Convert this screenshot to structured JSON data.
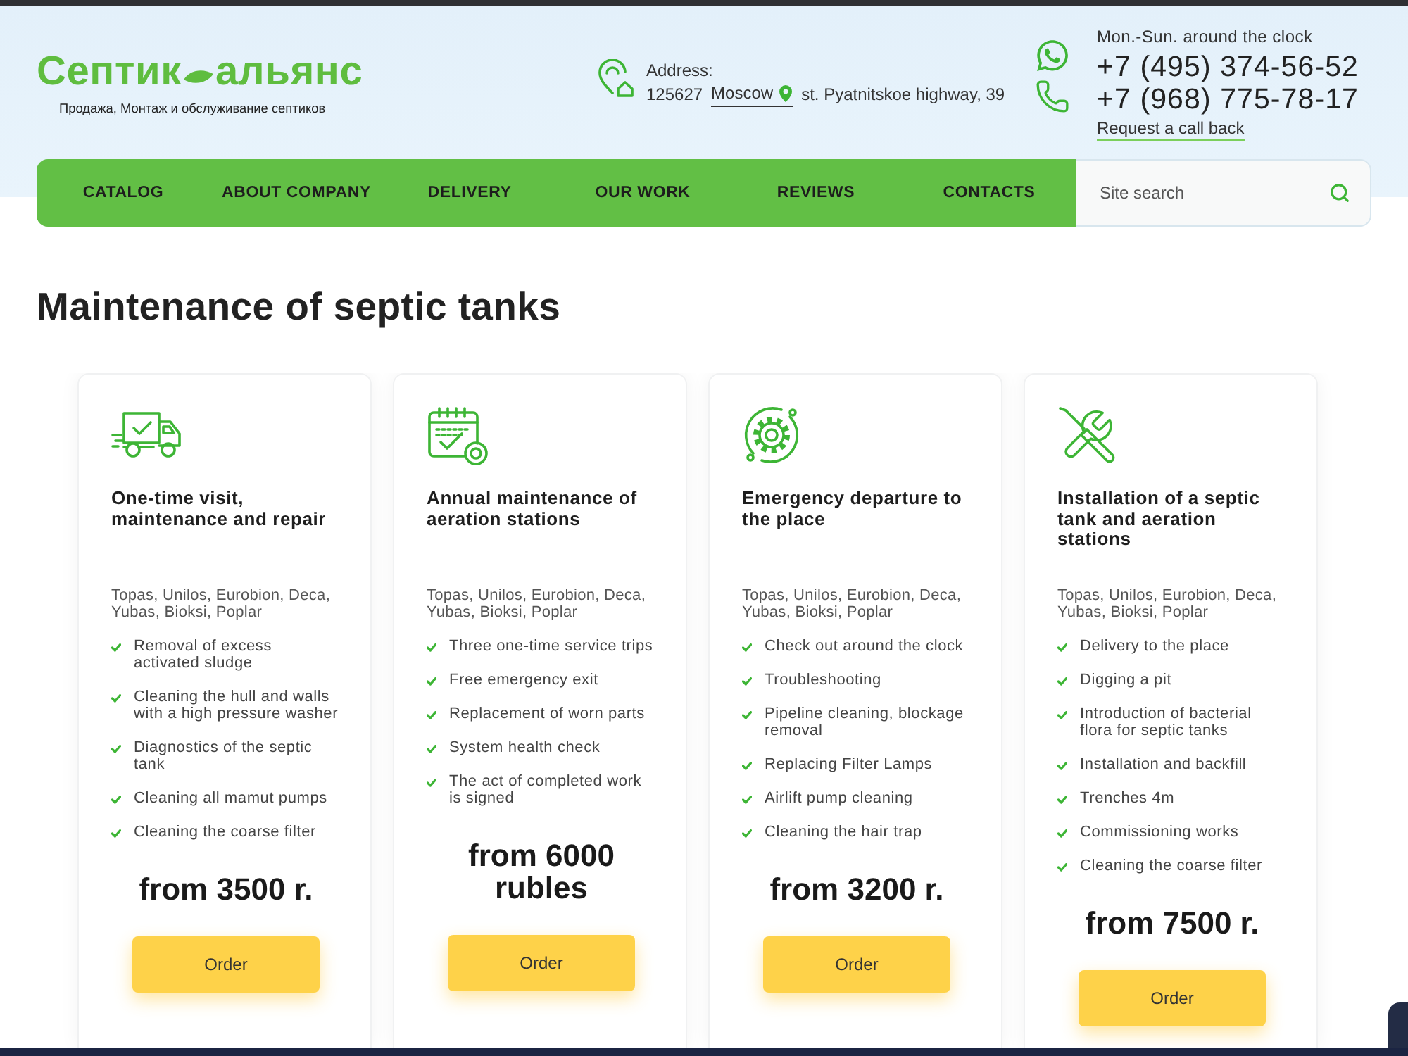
{
  "header": {
    "logo": {
      "word_left": "Септик",
      "word_right": "альянс",
      "tagline": "Продажа, Монтаж и обслуживание септиков"
    },
    "address": {
      "label": "Address:",
      "postcode": "125627",
      "city": "Moscow",
      "street": "st. Pyatnitskoe highway, 39"
    },
    "contacts": {
      "hours": "Mon.-Sun. around the clock",
      "phones": [
        "+7 (495) 374-56-52",
        "+7 (968) 775-78-17"
      ],
      "callback_link": "Request a call back"
    }
  },
  "nav": {
    "items": [
      "CATALOG",
      "ABOUT COMPANY",
      "DELIVERY",
      "OUR WORK",
      "REVIEWS",
      "CONTACTS"
    ],
    "search": {
      "placeholder": "Site search"
    }
  },
  "page_title": "Maintenance of septic tanks",
  "cards": [
    {
      "title": "One-time visit, maintenance and repair",
      "brands": "Topas, Unilos, Eurobion, Deca, Yubas, Bioksi, Poplar",
      "features": [
        "Removal of excess activated sludge",
        "Cleaning the hull and walls with a high pressure washer",
        "Diagnostics of the septic tank",
        "Cleaning all mamut pumps",
        "Cleaning the coarse filter"
      ],
      "price": "from 3500 r.",
      "button": "Order"
    },
    {
      "title": "Annual maintenance of aeration stations",
      "brands": "Topas, Unilos, Eurobion, Deca, Yubas, Bioksi, Poplar",
      "features": [
        "Three one-time service trips",
        "Free emergency exit",
        "Replacement of worn parts",
        "System health check",
        "The act of completed work is signed"
      ],
      "price": "from 6000 rubles",
      "button": "Order"
    },
    {
      "title": "Emergency departure to the place",
      "brands": "Topas, Unilos, Eurobion, Deca, Yubas, Bioksi, Poplar",
      "features": [
        "Check out around the clock",
        "Troubleshooting",
        "Pipeline cleaning, blockage removal",
        "Replacing Filter Lamps",
        "Airlift pump cleaning",
        "Cleaning the hair trap"
      ],
      "price": "from 3200 r.",
      "button": "Order"
    },
    {
      "title": "Installation of a septic tank and aeration stations",
      "brands": "Topas, Unilos, Eurobion, Deca, Yubas, Bioksi, Poplar",
      "features": [
        "Delivery to the place",
        "Digging a pit",
        "Introduction of bacterial flora for septic tanks",
        "Installation and backfill",
        "Trenches 4m",
        "Commissioning works",
        "Cleaning the coarse filter"
      ],
      "price": "from 7500 r.",
      "button": "Order"
    }
  ]
}
